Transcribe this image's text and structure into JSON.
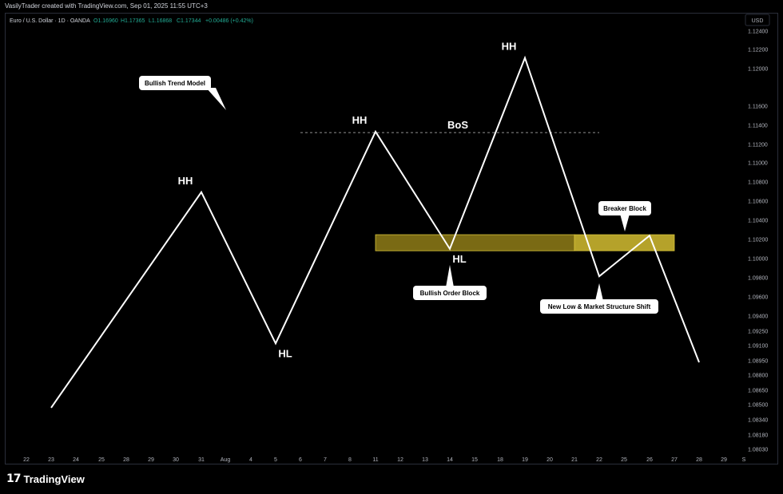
{
  "header": {
    "creator_line": "VasilyTrader created with TradingView.com, Sep 01, 2025 11:55 UTC+3"
  },
  "legend": {
    "symbol": "Euro / U.S. Dollar · 1D · OANDA",
    "open": "O1.16960",
    "high": "H1.17365",
    "low": "L1.16868",
    "close": "C1.17344",
    "change": "+0.00486 (+0.42%)",
    "value_color": "#22ab94"
  },
  "axis": {
    "currency_badge": "USD"
  },
  "branding": {
    "logo_text": "TradingView"
  },
  "colors": {
    "background": "#000000",
    "line": "#ffffff",
    "zone_fill": "#7a6a14",
    "zone_border": "#d8c33a",
    "breaker_fill": "#b5a22a"
  },
  "chart_data": {
    "type": "line",
    "title": "",
    "xlabel": "",
    "ylabel": "",
    "price_ticks": [
      "1.12400",
      "1.12200",
      "1.12000",
      "1.11600",
      "1.11400",
      "1.11200",
      "1.11000",
      "1.10800",
      "1.10600",
      "1.10400",
      "1.10200",
      "1.10000",
      "1.09800",
      "1.09600",
      "1.09400",
      "1.09250",
      "1.09100",
      "1.08950",
      "1.08800",
      "1.08650",
      "1.08500",
      "1.08340",
      "1.08180",
      "1.08030"
    ],
    "date_ticks": [
      "22",
      "23",
      "24",
      "25",
      "28",
      "29",
      "30",
      "31",
      "Aug",
      "4",
      "5",
      "6",
      "7",
      "8",
      "11",
      "12",
      "13",
      "14",
      "15",
      "18",
      "19",
      "20",
      "21",
      "22",
      "25",
      "26",
      "27",
      "28",
      "29",
      "S"
    ],
    "series": [
      {
        "points": [
          {
            "x": "23",
            "y": 1.0842
          },
          {
            "x": "31",
            "y": 1.107
          },
          {
            "x": "5",
            "y": 1.091
          },
          {
            "x": "11",
            "y": 1.1134
          },
          {
            "x": "14",
            "y": 1.101
          },
          {
            "x": "19",
            "y": 1.1212
          },
          {
            "x": "22",
            "y": 1.0981
          },
          {
            "x": "26",
            "y": 1.1024
          },
          {
            "x": "28",
            "y": 1.089
          }
        ]
      }
    ],
    "swing_labels": [
      {
        "text": "HH",
        "x": "31",
        "y": 1.107,
        "pos": "above"
      },
      {
        "text": "HL",
        "x": "5",
        "y": 1.091,
        "pos": "below"
      },
      {
        "text": "HH",
        "x": "11",
        "y": 1.1134,
        "pos": "above"
      },
      {
        "text": "HL",
        "x": "14",
        "y": 1.101,
        "pos": "below"
      },
      {
        "text": "HH",
        "x": "19",
        "y": 1.1212,
        "pos": "above"
      }
    ],
    "bos_line": {
      "label": "BoS",
      "y": 1.1133,
      "x_from": "6",
      "x_to": "22"
    },
    "zones": [
      {
        "name": "order-block",
        "x_from": "11",
        "x_to": "21",
        "y_top": 1.1025,
        "y_bottom": 1.1008
      },
      {
        "name": "breaker-block",
        "x_from": "21",
        "x_to": "27",
        "y_top": 1.1025,
        "y_bottom": 1.1008
      }
    ],
    "annotations": [
      {
        "text": "Bullish Trend Model",
        "x": "30",
        "y": 1.1177,
        "pointer": "down-right"
      },
      {
        "text": "Bullish Order Block",
        "x": "14",
        "y": 1.0964,
        "pointer": "up"
      },
      {
        "text": "Breaker Block",
        "x": "25",
        "y": 1.1059,
        "pointer": "down"
      },
      {
        "text": "New Low & Market Structure Shift",
        "x": "22",
        "y": 1.0951,
        "pointer": "up"
      }
    ]
  }
}
